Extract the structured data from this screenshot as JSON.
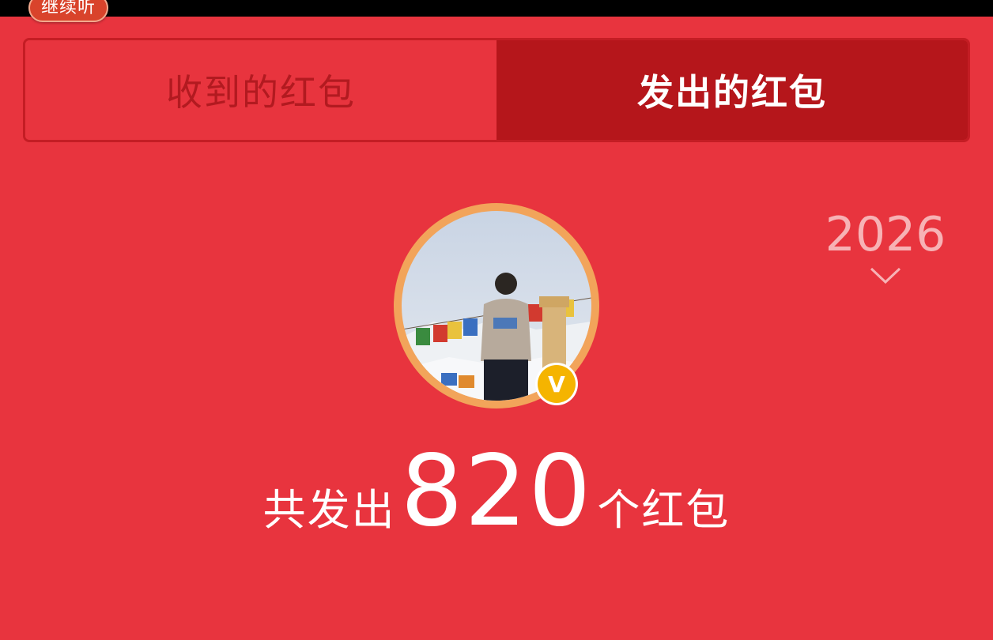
{
  "floating_player": {
    "continue_label": "继续听"
  },
  "tabs": [
    {
      "label": "收到的红包",
      "active": false
    },
    {
      "label": "发出的红包",
      "active": true
    }
  ],
  "year_selector": {
    "value": "2026",
    "icon": "chevron-down-icon"
  },
  "profile": {
    "avatar_icon": "user-avatar",
    "verified_badge_text": "V",
    "verified_icon": "verified-badge-icon"
  },
  "summary": {
    "prefix": "共发出",
    "count": "820",
    "suffix": "个红包"
  },
  "colors": {
    "background": "#e8343e",
    "tab_active_bg": "#b5161b",
    "tab_inactive_text": "#b21a20",
    "year_text": "#f7b2b5",
    "avatar_ring": "#f2a45a",
    "badge": "#f5b400"
  }
}
